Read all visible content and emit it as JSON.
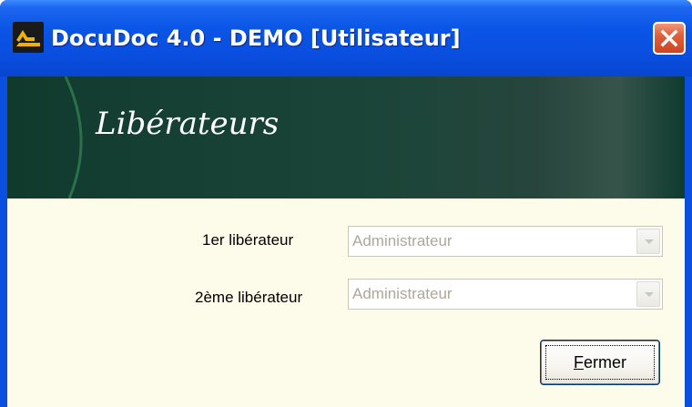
{
  "window": {
    "title": "DocuDoc 4.0 - DEMO [Utilisateur]",
    "accent_color": "#0a54e6",
    "close_icon": "close-icon"
  },
  "banner": {
    "title": "Libérateurs",
    "background_color": "#1b4538"
  },
  "form": {
    "first_label": "1er libérateur",
    "first_value": "Administrateur",
    "second_label": "2ème libérateur",
    "second_value": "Administrateur"
  },
  "footer": {
    "close_button_mnemonic": "F",
    "close_button_rest": "ermer"
  }
}
